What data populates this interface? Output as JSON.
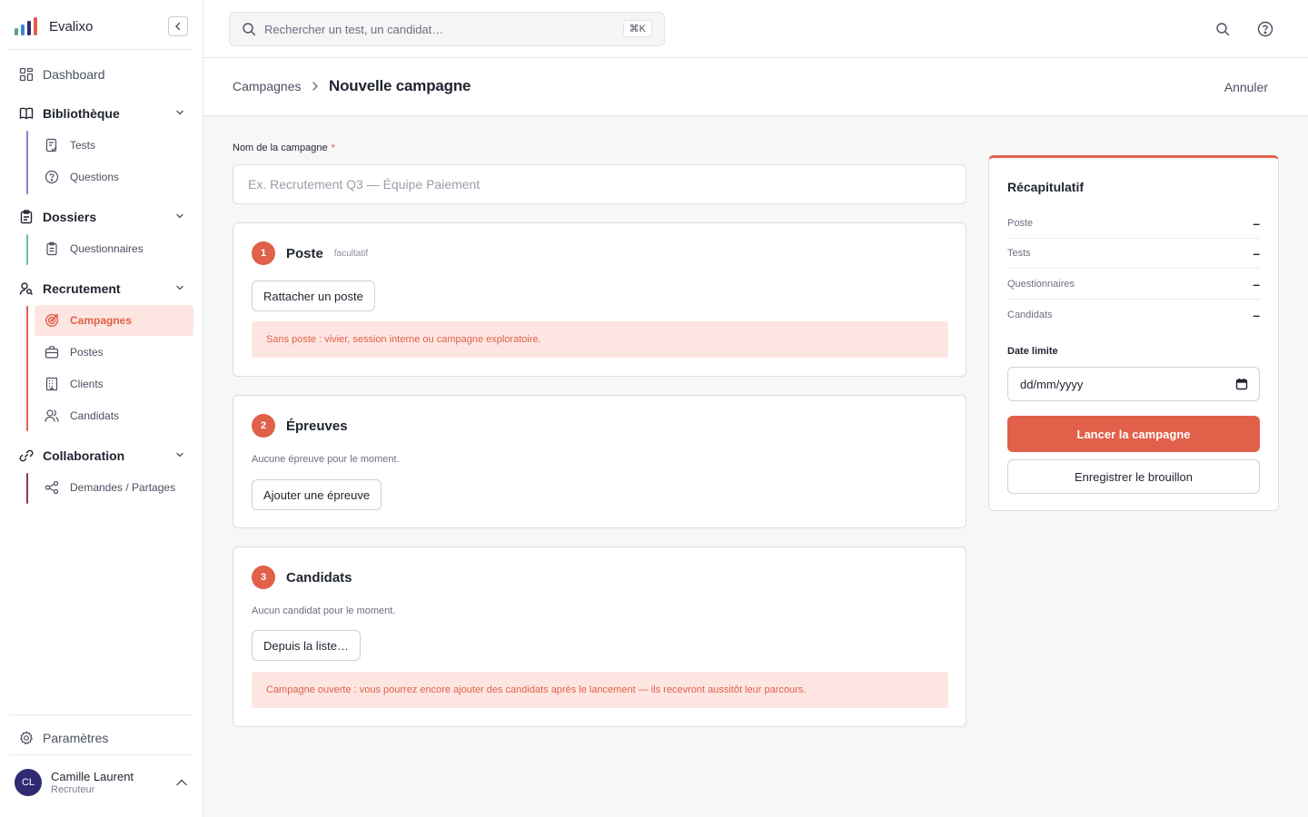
{
  "app": {
    "name": "Evalixo"
  },
  "sidebar": {
    "dashboard": "Dashboard",
    "groups": {
      "library": {
        "label": "Bibliothèque",
        "items": [
          "Tests",
          "Questions"
        ]
      },
      "files": {
        "label": "Dossiers",
        "items": [
          "Questionnaires"
        ]
      },
      "recruitment": {
        "label": "Recrutement",
        "items": [
          "Campagnes",
          "Postes",
          "Clients",
          "Candidats"
        ],
        "active": "Campagnes"
      },
      "collaboration": {
        "label": "Collaboration",
        "items": [
          "Demandes / Partages"
        ]
      }
    },
    "settings": "Paramètres",
    "user": {
      "initials": "CL",
      "name": "Camille Laurent",
      "role": "Recruteur"
    }
  },
  "topbar": {
    "search_placeholder": "Rechercher un test, un candidat…",
    "shortcut": "⌘K"
  },
  "page": {
    "breadcrumb": "Campagnes",
    "title": "Nouvelle campagne",
    "cancel": "Annuler"
  },
  "form": {
    "name_label": "Nom de la campagne",
    "name_required_mark": "*",
    "name_placeholder": "Ex. Recrutement Q3 — Équipe Paiement",
    "steps": {
      "position": {
        "number": "1",
        "title": "Poste",
        "optional": "facultatif",
        "button": "Rattacher un poste",
        "notice": "Sans poste : vivier, session interne ou campagne exploratoire."
      },
      "trials": {
        "number": "2",
        "title": "Épreuves",
        "empty": "Aucune épreuve pour le moment.",
        "button": "Ajouter une épreuve"
      },
      "candidates": {
        "number": "3",
        "title": "Candidats",
        "empty": "Aucun candidat pour le moment.",
        "button": "Depuis la liste…",
        "notice": "Campagne ouverte : vous pourrez encore ajouter des candidats après le lancement — ils recevront aussitôt leur parcours."
      }
    }
  },
  "summary": {
    "title": "Récapitulatif",
    "rows": [
      {
        "label": "Poste",
        "value": "–"
      },
      {
        "label": "Tests",
        "value": "–"
      },
      {
        "label": "Questionnaires",
        "value": "–"
      },
      {
        "label": "Candidats",
        "value": "–"
      }
    ],
    "deadline_label": "Date limite",
    "deadline_placeholder": "dd/mm/yyyy",
    "launch": "Lancer la campagne",
    "save_draft": "Enregistrer le brouillon"
  },
  "colors": {
    "accent": "#e0604a",
    "accent_soft": "#fde6e1",
    "text": "#1f2430",
    "avatar_bg": "#2f2a72",
    "library_line": "#8b7fd1",
    "files_line": "#6cc2a0",
    "recruitment_line": "#e0604a",
    "collaboration_line": "#8a3b4e"
  }
}
